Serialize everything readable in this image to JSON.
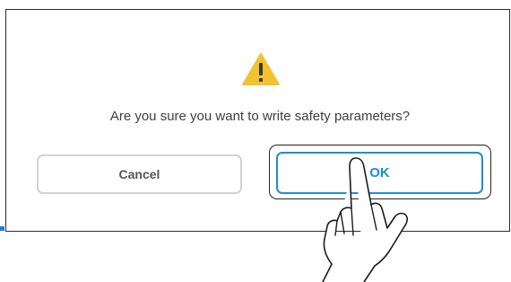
{
  "dialog": {
    "icon": "warning-icon",
    "message": "Are you sure you want to write safety parameters?",
    "cancel_label": "Cancel",
    "ok_label": "OK"
  },
  "colors": {
    "warning": "#f2c230",
    "accent": "#1e8fd0",
    "cancel_border": "#cfd3d7"
  },
  "overlay": {
    "icon": "pointing-hand-icon"
  }
}
